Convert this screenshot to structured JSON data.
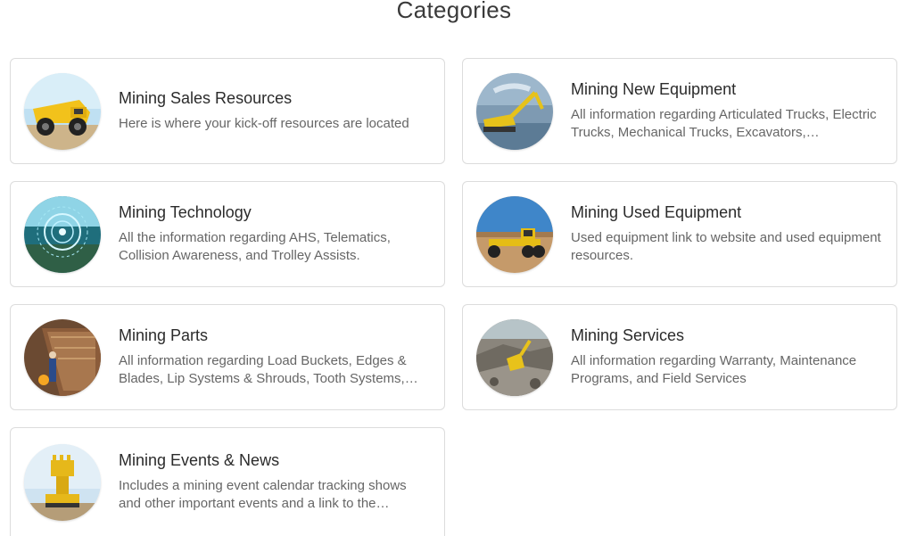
{
  "page": {
    "title": "Categories"
  },
  "categories": [
    {
      "title": "Mining Sales Resources",
      "description": "Here is where your kick-off resources are located",
      "image": "haul-truck-photo"
    },
    {
      "title": "Mining New Equipment",
      "description": "All information regarding Articulated Trucks, Electric Trucks, Mechanical Trucks, Excavators,…",
      "image": "excavator-photo"
    },
    {
      "title": "Mining Technology",
      "description": "All the information regarding AHS, Telematics, Collision Awareness, and Trolley Assists.",
      "image": "technology-globe-photo"
    },
    {
      "title": "Mining Used Equipment",
      "description": "Used equipment link to website and used equipment resources.",
      "image": "motor-grader-photo"
    },
    {
      "title": "Mining Parts",
      "description": "All information regarding Load Buckets, Edges & Blades, Lip Systems & Shrouds, Tooth Systems,…",
      "image": "bucket-parts-photo"
    },
    {
      "title": "Mining Services",
      "description": "All information regarding Warranty, Maintenance Programs, and Field Services",
      "image": "site-services-photo"
    },
    {
      "title": "Mining Events & News",
      "description": "Includes a mining event calendar tracking shows and other important events and a link to the…",
      "image": "shovel-loader-photo"
    }
  ]
}
